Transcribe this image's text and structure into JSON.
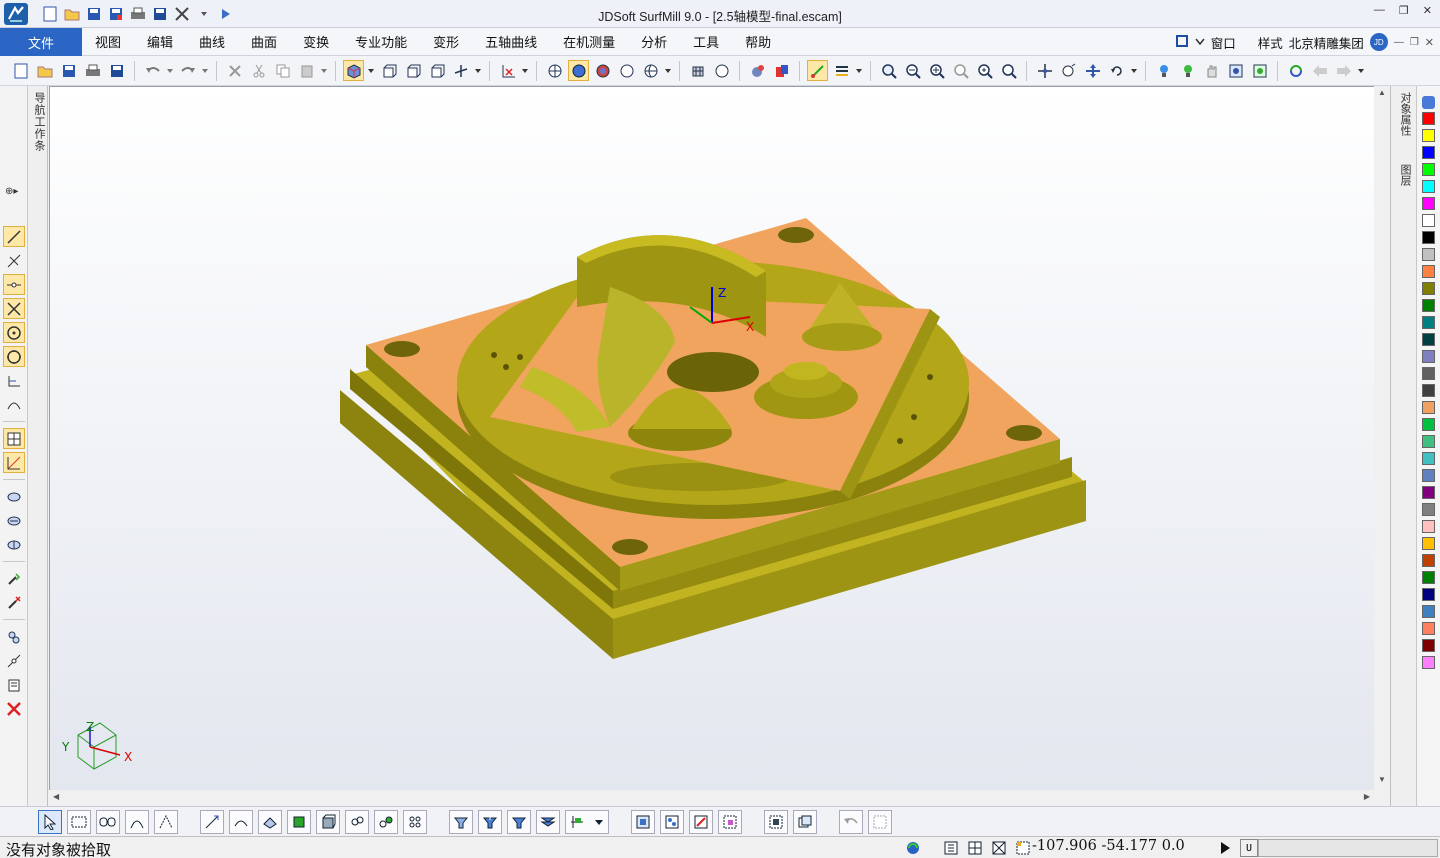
{
  "window": {
    "title": "JDSoft SurfMill 9.0 - [2.5轴模型-final.escam]"
  },
  "menu": {
    "file": "文件",
    "items": [
      "视图",
      "编辑",
      "曲线",
      "曲面",
      "变换",
      "专业功能",
      "变形",
      "五轴曲线",
      "在机测量",
      "分析",
      "工具",
      "帮助"
    ],
    "right": {
      "window": "窗口",
      "style": "样式",
      "company": "北京精雕集团",
      "badge": "JD"
    }
  },
  "left_tab": {
    "label": "导航工作条"
  },
  "right_tabs": {
    "properties": "对象属性",
    "layers": "图层"
  },
  "viewport": {
    "axis_labels": {
      "x": "X",
      "y": "Y",
      "z": "Z"
    }
  },
  "palette_colors": [
    "#ff0000",
    "#ffff00",
    "#0000ff",
    "#00ff00",
    "#00ffff",
    "#ff00ff",
    "#ffffff",
    "#000000",
    "#c0c0c0",
    "#ff8040",
    "#808000",
    "#008000",
    "#008080",
    "#004040",
    "#8080c0",
    "#606060",
    "#404040",
    "#f0a060",
    "#00c040",
    "#40c080",
    "#40c0c0",
    "#6080c0",
    "#800080",
    "#808080",
    "#ffc0c0",
    "#ffc000",
    "#c04000",
    "#008000",
    "#000080",
    "#4080c0",
    "#ff8060",
    "#800000",
    "#ff80ff"
  ],
  "status": {
    "message": "没有对象被拾取",
    "coordinates": "-107.906  -54.177  0.0",
    "mode": "U"
  }
}
